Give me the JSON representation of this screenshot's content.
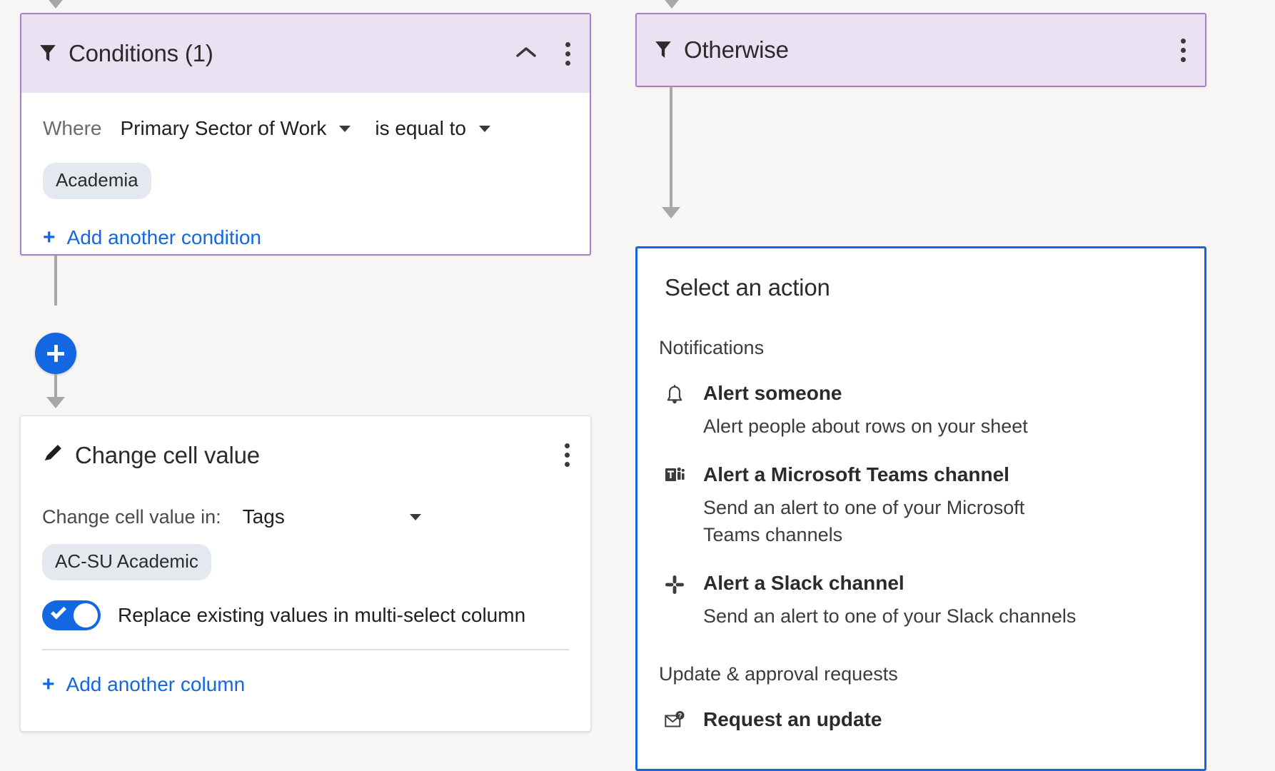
{
  "colors": {
    "accent_blue": "#1367e0",
    "purple_border": "#a87fcd",
    "purple_fill": "#eae2f3",
    "chip_bg": "#e4e9ef",
    "canvas_bg": "#f7f6f4",
    "connector_gray": "#a8a8a8"
  },
  "conditions_card": {
    "header": {
      "icon": "funnel-icon",
      "title": "Conditions (1)",
      "collapse_icon": "chevron-up-icon",
      "menu_icon": "kebab-menu-icon"
    },
    "where_label": "Where",
    "field_dropdown": "Primary Sector of Work",
    "operator_dropdown": "is equal to",
    "value_chip": "Academia",
    "add_condition_link": "Add another condition",
    "add_condition_plus": "+"
  },
  "otherwise_card": {
    "header": {
      "icon": "funnel-icon",
      "title": "Otherwise",
      "menu_icon": "kebab-menu-icon"
    }
  },
  "add_step_button": {
    "icon": "plus-icon",
    "label": "+"
  },
  "change_cell_value_card": {
    "header": {
      "icon": "pencil-icon",
      "title": "Change cell value",
      "menu_icon": "kebab-menu-icon"
    },
    "field_label": "Change cell value in:",
    "column_dropdown": "Tags",
    "value_chip": "AC-SU Academic",
    "toggle": {
      "label": "Replace existing values in multi-select column",
      "state": "on"
    },
    "add_column_link": "Add another column",
    "add_column_plus": "+"
  },
  "action_panel": {
    "title": "Select an action",
    "groups": [
      {
        "label": "Notifications",
        "items": [
          {
            "icon": "bell-icon",
            "name": "Alert someone",
            "description": "Alert people about rows on your sheet"
          },
          {
            "icon": "microsoft-teams-icon",
            "name": "Alert a Microsoft Teams channel",
            "description": "Send an alert to one of your Microsoft Teams channels"
          },
          {
            "icon": "slack-icon",
            "name": "Alert a Slack channel",
            "description": "Send an alert to one of your Slack channels"
          }
        ]
      },
      {
        "label": "Update & approval requests",
        "items": [
          {
            "icon": "request-update-envelope-icon",
            "name": "Request an update",
            "description": ""
          }
        ]
      }
    ]
  }
}
